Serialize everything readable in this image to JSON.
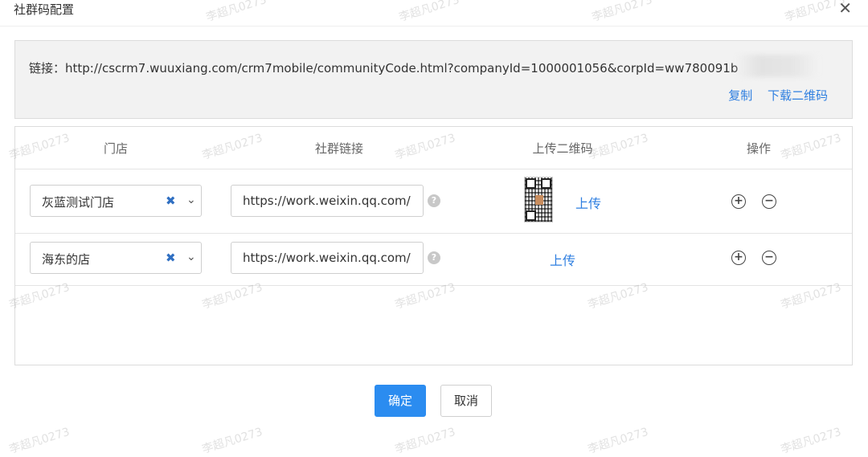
{
  "dialog": {
    "title": "社群码配置",
    "close_glyph": "✕",
    "link_label": "链接：",
    "link_url": "http://cscrm7.wuuxiang.com/crm7mobile/communityCode.html?companyId=1000001056&corpId=ww780091b",
    "copy_label": "复制",
    "download_label": "下载二维码"
  },
  "table": {
    "headers": [
      "门店",
      "社群链接",
      "上传二维码",
      "操作"
    ],
    "rows": [
      {
        "store": "灰蓝测试门店",
        "link": "https://work.weixin.qq.com/",
        "has_qr": true,
        "upload_label": "上传"
      },
      {
        "store": "海东的店",
        "link": "https://work.weixin.qq.com/",
        "has_qr": false,
        "upload_label": "上传"
      }
    ]
  },
  "icons": {
    "clear": "✖",
    "caret": "⌄",
    "help": "?",
    "add": "+",
    "remove": "−"
  },
  "footer": {
    "ok_label": "确定",
    "cancel_label": "取消"
  },
  "watermark": "李超凡0273",
  "colors": {
    "accent": "#2b8cf0",
    "link": "#2f7fe0",
    "panel_bg": "#f2f2f2"
  }
}
